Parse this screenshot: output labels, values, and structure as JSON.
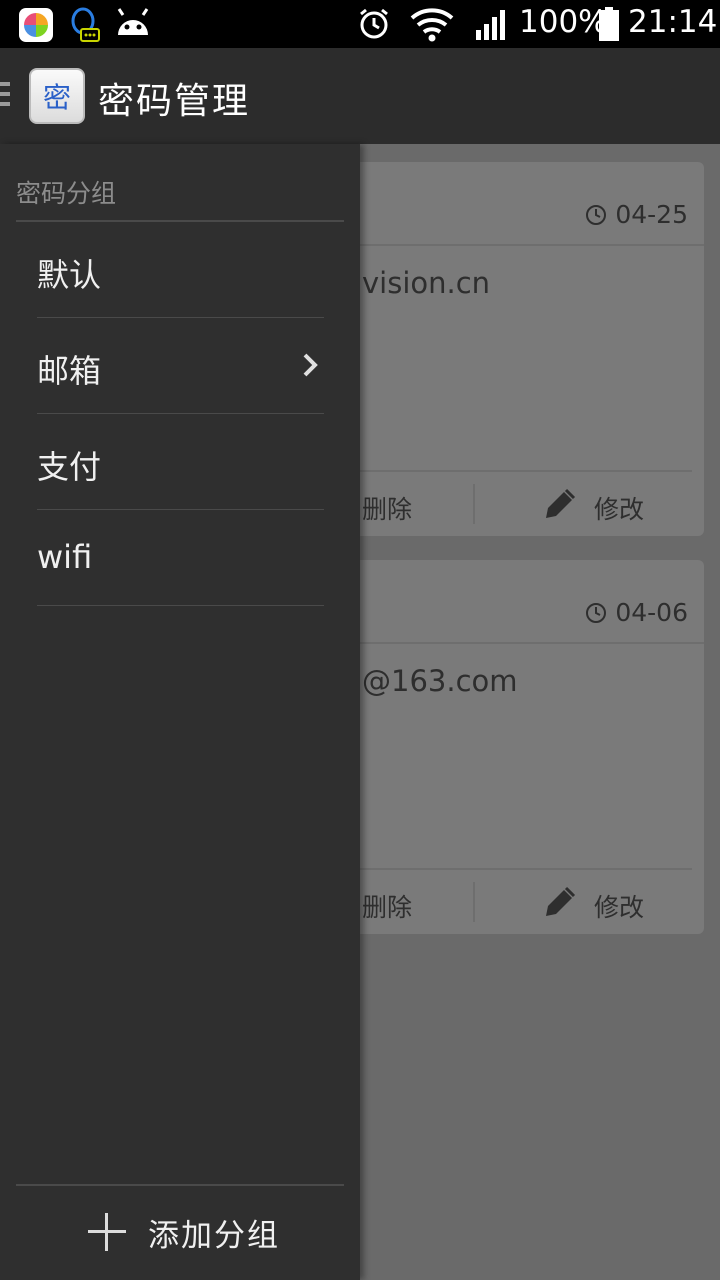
{
  "status_bar": {
    "battery": "100%",
    "time": "21:14",
    "icons": [
      "app-store-icon",
      "qq-icon",
      "android-icon",
      "alarm-icon",
      "wifi-icon",
      "signal-icon",
      "battery-icon"
    ]
  },
  "action_bar": {
    "app_icon_glyph": "密",
    "title": "密码管理"
  },
  "drawer": {
    "header": "密码分组",
    "groups": [
      {
        "label": "默认"
      },
      {
        "label": "邮箱",
        "has_chevron": true
      },
      {
        "label": "支付"
      },
      {
        "label": "wifi"
      }
    ],
    "add_group_label": "添加分组"
  },
  "cards": [
    {
      "date": "04-25",
      "account": "vision.cn",
      "delete_label": "删除",
      "edit_label": "修改"
    },
    {
      "date": "04-06",
      "account": "@163.com",
      "delete_label": "删除",
      "edit_label": "修改"
    }
  ],
  "colors": {
    "drawer_bg": "#2f2f2f",
    "action_bar_bg": "#2c2c2c",
    "scrim": "#6a6a6a"
  }
}
